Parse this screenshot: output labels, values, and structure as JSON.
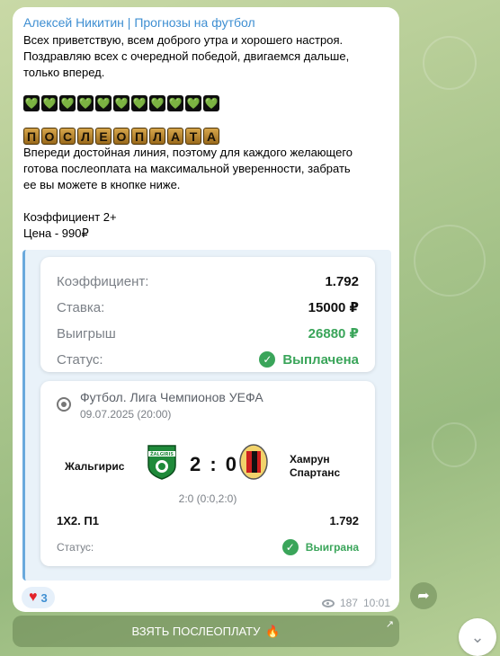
{
  "channel": {
    "sender": "Алексей Никитин | Прогнозы на футбол"
  },
  "message": {
    "greeting_lines": [
      "Всех приветствую, всем доброго утра и хорошего настроя.",
      "Поздравляю всех с очередной победой, двигаемся дальше,",
      "только вперед."
    ],
    "heart_emojis": [
      "💚",
      "💚",
      "💚",
      "💚",
      "💚",
      "💚",
      "💚",
      "💚",
      "💚",
      "💚",
      "💚"
    ],
    "title_letters": [
      "П",
      "О",
      "С",
      "Л",
      "Е",
      "О",
      "П",
      "Л",
      "А",
      "Т",
      "А"
    ],
    "body_lines": [
      "Впереди достойная линия, поэтому для каждого желающего",
      "готова послеоплата на максимальной уверенности, забрать",
      "ее вы можете в кнопке ниже."
    ],
    "coefficient": "Коэффициент 2+",
    "price": "Цена - 990₽"
  },
  "bet_card": {
    "rows": [
      {
        "label": "Коэффициент:",
        "value": "1.792"
      },
      {
        "label": "Ставка:",
        "value": "15000 ₽"
      },
      {
        "label": "Выигрыш",
        "value": "26880 ₽"
      }
    ],
    "status_label": "Статус:",
    "status_value": "Выплачена"
  },
  "match_card": {
    "league": "Футбол. Лига Чемпионов УЕФА",
    "date": "09.07.2025 (20:00)",
    "home_team": "Жальгирис",
    "home_crest_text": "ŽALGIRIS",
    "away_team_line1": "Хамрун",
    "away_team_line2": "Спартанс",
    "score": "2 : 0",
    "halftime": "2:0 (0:0,2:0)",
    "bet_type": "1Х2. П1",
    "bet_odds": "1.792",
    "status_label": "Статус:",
    "status_value": "Выиграна"
  },
  "footer": {
    "reaction_count": "3",
    "views": "187",
    "time": "10:01"
  },
  "button": {
    "label": "ВЗЯТЬ ПОСЛЕОПЛАТУ",
    "emoji": "🔥"
  },
  "colors": {
    "link": "#3f8fd2",
    "success": "#3aa55a",
    "quote_bar": "#6aa9dc"
  }
}
